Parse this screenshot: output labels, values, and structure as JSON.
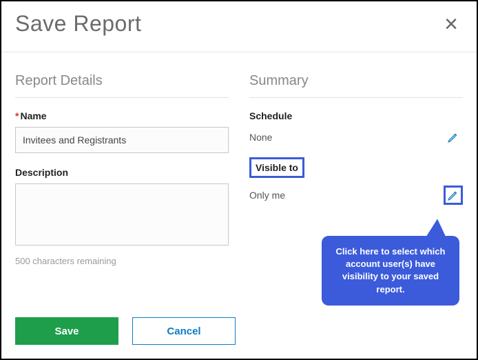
{
  "dialog": {
    "title": "Save Report",
    "close_glyph": "×"
  },
  "details": {
    "section_title": "Report Details",
    "name_label": "Name",
    "name_value": "Invitees and Registrants",
    "description_label": "Description",
    "description_value": "",
    "char_remaining": "500 characters remaining"
  },
  "summary": {
    "section_title": "Summary",
    "schedule_label": "Schedule",
    "schedule_value": "None",
    "visible_to_label": "Visible to",
    "visible_to_value": "Only me"
  },
  "actions": {
    "save": "Save",
    "cancel": "Cancel"
  },
  "annotation": {
    "callout_text": "Click here to select which account user(s) have visibility to your saved report."
  }
}
